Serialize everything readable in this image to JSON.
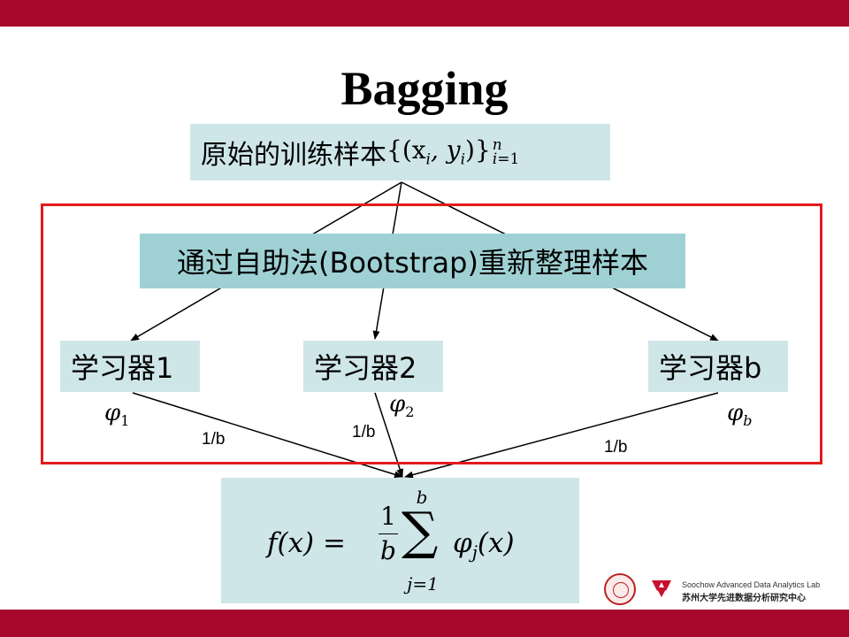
{
  "slide": {
    "title": "Bagging",
    "samples_label": "原始的训练样本",
    "bootstrap_label": "通过自助法(Bootstrap)重新整理样本",
    "learners": [
      "学习器1",
      "学习器2",
      "学习器b"
    ],
    "learner_symbols": [
      {
        "base": "φ",
        "sub": "1"
      },
      {
        "base": "φ",
        "sub": "2"
      },
      {
        "base": "φ",
        "sub": "b"
      }
    ],
    "weights": [
      "1/b",
      "1/b",
      "1/b"
    ],
    "formula": {
      "lhs": "f(x) =",
      "numerator": "1",
      "denominator": "b",
      "sum_upper": "b",
      "sum_lower": "j=1",
      "rhs": "φ",
      "rhs_sub": "j",
      "rhs_arg": "(x)"
    }
  },
  "footer": {
    "lab_name": "Soochow Advanced Data Analytics Lab",
    "lab_name_cn": "苏州大学先进数据分析研究中心"
  },
  "colors": {
    "bar": "#a8072c",
    "box": "#cfe6e8",
    "box_dark": "#9fd1d4",
    "frame": "#e31b1b"
  }
}
